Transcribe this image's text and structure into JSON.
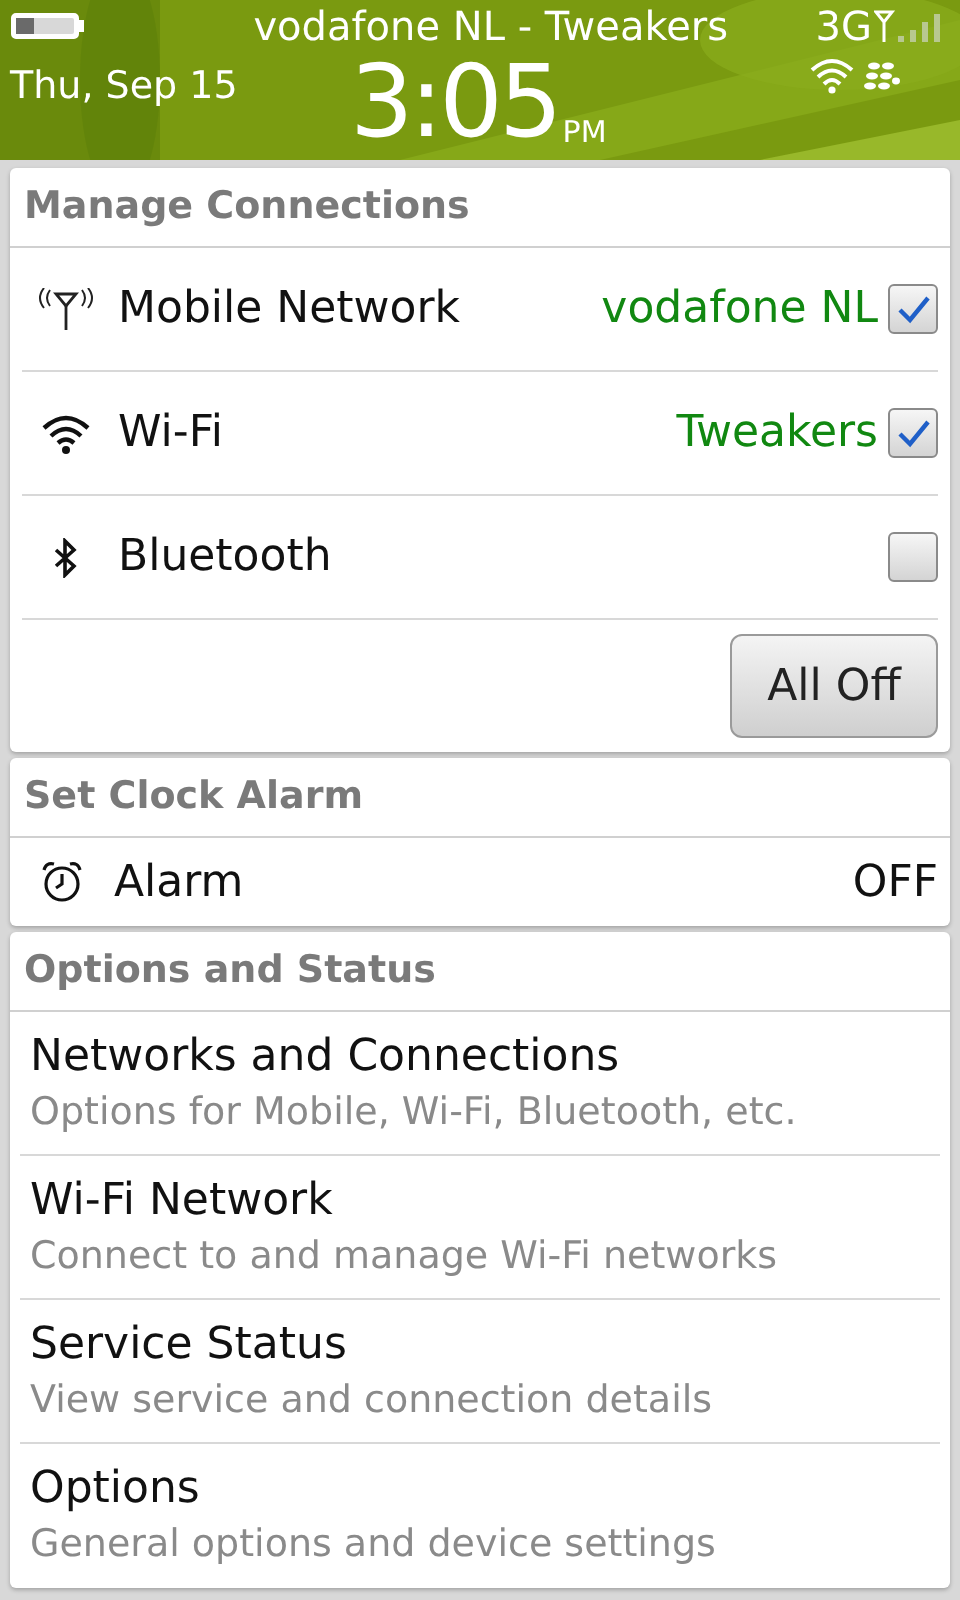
{
  "status_bar": {
    "carrier": "vodafone NL - Tweakers",
    "network": "3G",
    "date": "Thu, Sep 15",
    "time": "3:05",
    "ampm": "PM"
  },
  "manage_connections": {
    "title": "Manage Connections",
    "items": [
      {
        "kind": "mobile",
        "label": "Mobile Network",
        "value": "vodafone NL",
        "checked": true
      },
      {
        "kind": "wifi",
        "label": "Wi-Fi",
        "value": "Tweakers",
        "checked": true
      },
      {
        "kind": "bluetooth",
        "label": "Bluetooth",
        "checked": false
      }
    ],
    "button": "All Off"
  },
  "clock_alarm": {
    "title": "Set Clock Alarm",
    "label": "Alarm",
    "value": "OFF"
  },
  "options_status": {
    "title": "Options and Status",
    "items": [
      {
        "title": "Networks and Connections",
        "subtitle": "Options for Mobile, Wi-Fi, Bluetooth, etc."
      },
      {
        "title": "Wi-Fi Network",
        "subtitle": "Connect to and manage Wi-Fi networks"
      },
      {
        "title": "Service Status",
        "subtitle": "View service and connection details"
      },
      {
        "title": "Options",
        "subtitle": "General options and device settings"
      }
    ]
  }
}
